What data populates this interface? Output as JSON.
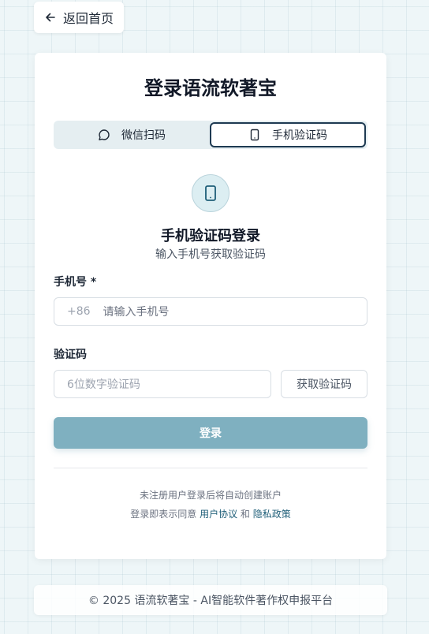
{
  "nav": {
    "back_label": "返回首页",
    "back_icon": "arrow-left-icon"
  },
  "login": {
    "title": "登录语流软著宝",
    "tabs": [
      {
        "label": "微信扫码",
        "icon": "chat-bubble-icon",
        "active": false
      },
      {
        "label": "手机验证码",
        "icon": "smartphone-icon",
        "active": true
      }
    ],
    "method_icon": "smartphone-icon",
    "method_title": "手机验证码登录",
    "method_desc": "输入手机号获取验证码",
    "phone_label": "手机号 *",
    "phone_prefix": "+86",
    "phone_placeholder": "请输入手机号",
    "code_label": "验证码",
    "code_placeholder": "6位数字验证码",
    "get_code_label": "获取验证码",
    "submit_label": "登录",
    "note_line1": "未注册用户登录后将自动创建账户",
    "agree_prefix": "登录即表示同意",
    "terms_link": "用户协议",
    "and_text": "和",
    "privacy_link": "隐私政策"
  },
  "footer": {
    "text": "© 2025 语流软著宝 - AI智能软件著作权申报平台"
  },
  "colors": {
    "accent": "#1e5e78",
    "button": "#7fb0c0",
    "tab_active_border": "#1e3a52",
    "background": "#eef6f8"
  }
}
